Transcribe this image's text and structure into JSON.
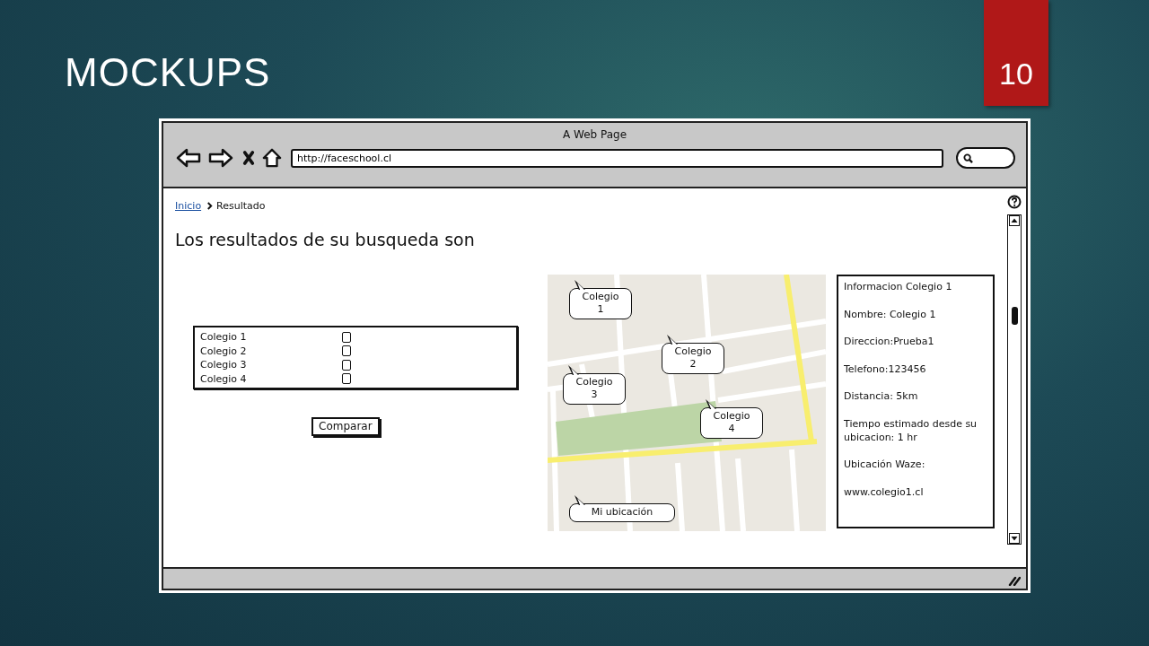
{
  "slide": {
    "title": "MOCKUPS",
    "page_number": "10"
  },
  "window": {
    "title": "A Web Page",
    "address": "http://faceschool.cl"
  },
  "breadcrumb": [
    {
      "label": "Inicio",
      "kind": "link"
    },
    {
      "label": "Resultado",
      "kind": "current"
    }
  ],
  "heading": "Los resultados de su busqueda son",
  "schools": [
    {
      "name": "Colegio 1",
      "checked": false
    },
    {
      "name": "Colegio 2",
      "checked": false
    },
    {
      "name": "Colegio 3",
      "checked": false
    },
    {
      "name": "Colegio 4",
      "checked": false
    }
  ],
  "compare_button": "Comparar",
  "map": {
    "callouts": [
      {
        "label": "Colegio 1"
      },
      {
        "label": "Colegio 2"
      },
      {
        "label": "Colegio 3"
      },
      {
        "label": "Colegio 4"
      },
      {
        "label": "Mi ubicación"
      }
    ]
  },
  "info": {
    "lines": [
      "Informacion Colegio 1",
      "Nombre: Colegio 1",
      "Direccion:Prueba1",
      "Telefono:123456",
      "Distancia: 5km",
      "Tiempo estimado desde su ubicacion: 1 hr",
      "Ubicación Waze:",
      "www.colegio1.cl"
    ]
  }
}
